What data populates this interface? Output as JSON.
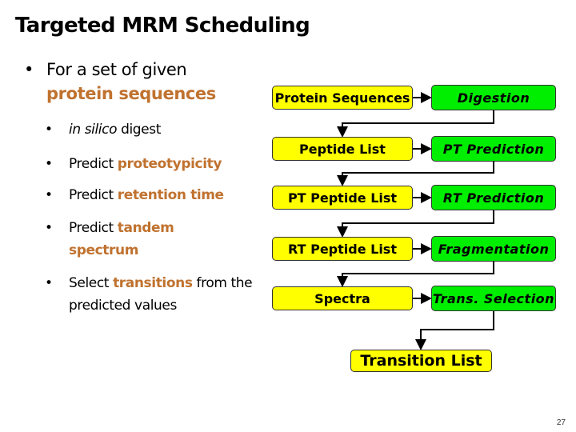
{
  "slide": {
    "title": "Targeted MRM Scheduling",
    "page_number": "27"
  },
  "bullets": {
    "main": {
      "prefix": "For a set of given",
      "highlight": "protein sequences"
    },
    "sub": [
      {
        "italic": "in silico",
        "text": " digest"
      },
      {
        "text": "Predict ",
        "highlight": "proteotypicity"
      },
      {
        "text": "Predict ",
        "highlight": "retention time"
      },
      {
        "text": "Predict ",
        "highlight": "tandem spectrum"
      },
      {
        "text": "Select ",
        "highlight": "transitions",
        "suffix": " from the predicted values"
      }
    ],
    "bullet_char": "•"
  },
  "flowchart": {
    "colors": {
      "data_node": "#ffff00",
      "process_node": "#00ee00",
      "highlight_text": "#c0722f"
    },
    "rows": [
      {
        "data": "Protein Sequences",
        "process": "Digestion"
      },
      {
        "data": "Peptide List",
        "process": "PT Prediction"
      },
      {
        "data": "PT Peptide List",
        "process": "RT Prediction"
      },
      {
        "data": "RT Peptide List",
        "process": "Fragmentation"
      },
      {
        "data": "Spectra",
        "process": "Trans. Selection"
      }
    ],
    "output": "Transition List"
  }
}
